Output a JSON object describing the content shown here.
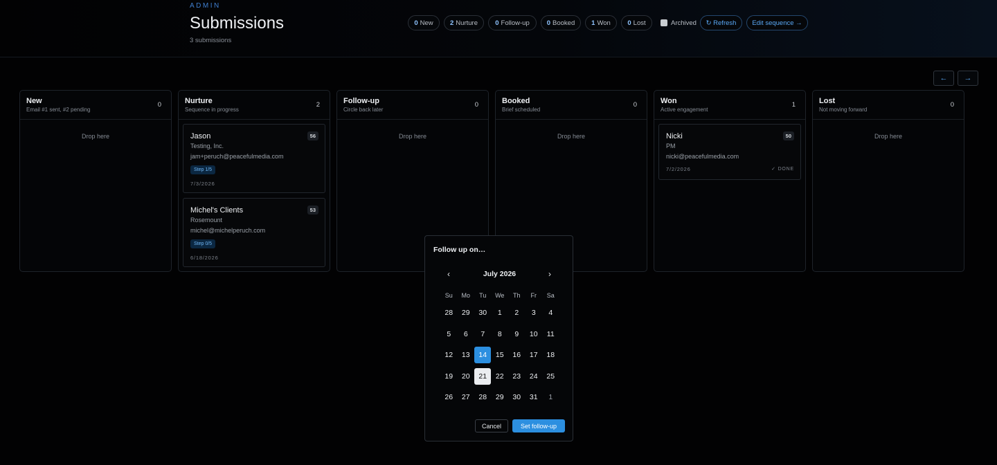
{
  "header": {
    "eyebrow": "ADMIN",
    "title": "Submissions",
    "subtitle": "3 submissions",
    "filters": [
      {
        "count": "0",
        "label": "New"
      },
      {
        "count": "2",
        "label": "Nurture"
      },
      {
        "count": "0",
        "label": "Follow-up"
      },
      {
        "count": "0",
        "label": "Booked"
      },
      {
        "count": "1",
        "label": "Won"
      },
      {
        "count": "0",
        "label": "Lost"
      }
    ],
    "archived_label": "Archived",
    "refresh_label": "↻ Refresh",
    "edit_sequence_label": "Edit sequence →"
  },
  "board_nav": {
    "prev": "←",
    "next": "→"
  },
  "columns": [
    {
      "title": "New",
      "subtitle": "Email #1 sent, #2 pending",
      "count": "0",
      "drop": "Drop here"
    },
    {
      "title": "Nurture",
      "subtitle": "Sequence in progress",
      "count": "2"
    },
    {
      "title": "Follow-up",
      "subtitle": "Circle back later",
      "count": "0",
      "drop": "Drop here"
    },
    {
      "title": "Booked",
      "subtitle": "Brief scheduled",
      "count": "0",
      "drop": "Drop here"
    },
    {
      "title": "Won",
      "subtitle": "Active engagement",
      "count": "1"
    },
    {
      "title": "Lost",
      "subtitle": "Not moving forward",
      "count": "0",
      "drop": "Drop here"
    }
  ],
  "cards": {
    "jason": {
      "name": "Jason",
      "company": "Testing, Inc.",
      "email": "jam+peruch@peacefulmedia.com",
      "score": "56",
      "step": "Step 1/5",
      "date": "7/3/2026"
    },
    "michel": {
      "name": "Michel's Clients",
      "company": "Rosemount",
      "email": "michel@michelperuch.com",
      "score": "53",
      "step": "Step 0/5",
      "date": "6/18/2026"
    },
    "nicki": {
      "name": "Nicki",
      "company": "PM",
      "email": "nicki@peacefulmedia.com",
      "score": "50",
      "date": "7/2/2026",
      "status": "✓ DONE"
    }
  },
  "followup_modal": {
    "title": "Follow up on…",
    "month": "July 2026",
    "prev_icon": "‹",
    "next_icon": "›",
    "weekdays": [
      "Su",
      "Mo",
      "Tu",
      "We",
      "Th",
      "Fr",
      "Sa"
    ],
    "days": [
      "28",
      "29",
      "30",
      "1",
      "2",
      "3",
      "4",
      "5",
      "6",
      "7",
      "8",
      "9",
      "10",
      "11",
      "12",
      "13",
      "14",
      "15",
      "16",
      "17",
      "18",
      "19",
      "20",
      "21",
      "22",
      "23",
      "24",
      "25",
      "26",
      "27",
      "28",
      "29",
      "30",
      "31",
      "1"
    ],
    "selected_day": "14",
    "today": "21",
    "cancel_label": "Cancel",
    "submit_label": "Set follow-up"
  },
  "colors": {
    "accent": "#2c8fe0",
    "link": "#5aa8f5",
    "background": "#020203"
  }
}
